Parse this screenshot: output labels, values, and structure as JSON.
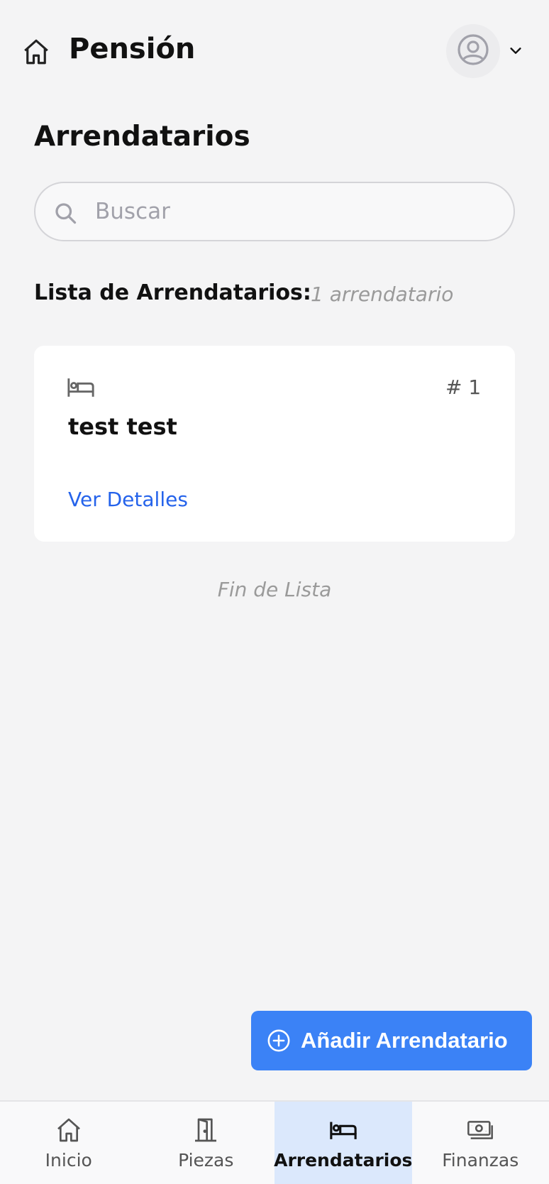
{
  "header": {
    "title": "Pensión",
    "icons": {
      "home": "home-icon",
      "avatar": "user-circle-icon",
      "menu": "chevron-down-icon"
    }
  },
  "page": {
    "title": "Arrendatarios"
  },
  "search": {
    "placeholder": "Buscar",
    "value": ""
  },
  "list": {
    "label": "Lista de Arrendatarios:",
    "count": "1 arrendatario",
    "items": [
      {
        "number": "# 1",
        "name": "test test",
        "action": "Ver Detalles",
        "icon": "bed-icon"
      }
    ],
    "end_text": "Fin de Lista"
  },
  "fab": {
    "label": "Añadir Arrendatario",
    "icon": "plus-circle-icon"
  },
  "bottom_nav": {
    "items": [
      {
        "label": "Inicio",
        "icon": "home-icon",
        "active": false
      },
      {
        "label": "Piezas",
        "icon": "door-icon",
        "active": false
      },
      {
        "label": "Arrendatarios",
        "icon": "bed-icon",
        "active": true
      },
      {
        "label": "Finanzas",
        "icon": "cash-icon",
        "active": false
      }
    ]
  },
  "colors": {
    "background": "#f4f4f5",
    "accent": "#3b82f6",
    "link": "#2563eb",
    "active_tab": "#dbe8fc"
  }
}
